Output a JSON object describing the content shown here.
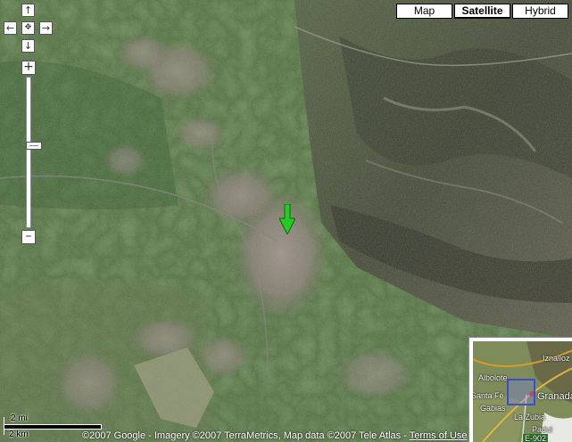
{
  "map_types": [
    {
      "label": "Map",
      "active": false
    },
    {
      "label": "Satellite",
      "active": true
    },
    {
      "label": "Hybrid",
      "active": false
    }
  ],
  "pan": {
    "up": "↑",
    "left": "←",
    "center": "✥",
    "right": "→",
    "down": "↓"
  },
  "zoom": {
    "in": "+",
    "out": "–",
    "level_fraction": 0.45
  },
  "marker": {
    "color": "#22cc22",
    "icon": "green-arrow-marker"
  },
  "overview": {
    "labels": [
      "Albolote",
      "Iznalloz",
      "Santa Fé",
      "Granada",
      "Gabias",
      "La Zubia",
      "Padul",
      "E-902"
    ]
  },
  "scale": {
    "top_label": "2 mi",
    "bottom_label": "2 km"
  },
  "copyright": {
    "text": "©2007 Google - Imagery ©2007 TerraMetrics, Map data ©2007 Tele Atlas - ",
    "terms_link": "Terms of Use"
  },
  "colors": {
    "overview_box": "#3c4fc8",
    "button_border": "#000000"
  }
}
